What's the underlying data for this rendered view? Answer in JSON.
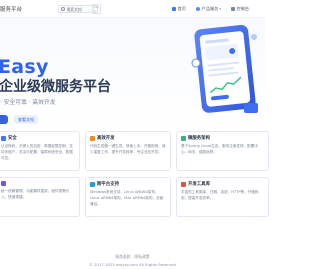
{
  "header": {
    "brand": "服务平台",
    "search_placeholder": "搜索文档",
    "search_shortcut": "Ctrl K",
    "nav": [
      {
        "label": "首页",
        "icon": "home-icon"
      },
      {
        "label": "产品服务",
        "icon": "grid-icon"
      },
      {
        "label": "控制台",
        "icon": "monitor-icon"
      }
    ]
  },
  "hero": {
    "title": "Easy",
    "subtitle": "企业级微服务平台",
    "tagline": "· 安全可靠 · 高效开发",
    "secondary_button": "查看文档",
    "accent_color": "#2f62f0"
  },
  "features": [
    {
      "title": "安全",
      "icon": "shield-icon",
      "icon_color": "#3d7bf5",
      "desc": "认证授权、无侵入的加密、数据权限控制，支持多租户、灵活可配置，保障系统安全、数据可控。"
    },
    {
      "title": "高效开发",
      "icon": "rocket-icon",
      "icon_color": "#f08a24",
      "desc": "代码生成器一键生成，快速上手，开箱即用，减少重复工作，提升开发效率，专注业务开发。"
    },
    {
      "title": "微服务架构",
      "icon": "cluster-icon",
      "icon_color": "#35b37e",
      "desc": "基于Spring Cloud生态，服务注册发现、配置中心、网关、链路追踪。"
    },
    {
      "title": "",
      "icon": "code-icon",
      "icon_color": "#6a5ae0",
      "desc": "统一依赖管理、功能模块插拔、组件按需引入，快速搭建。"
    },
    {
      "title": "跨平台支持",
      "icon": "monitor-icon",
      "icon_color": "#1f9fd9",
      "desc": "Windows系统支持，Linux AMD64架构，Linux ARM64架构，Mac ARM64架构，全面兼容。"
    },
    {
      "title": "开发工具库",
      "icon": "toolbox-icon",
      "icon_color": "#e2513b",
      "desc": "丰富的工具类库，日期、加密、HTTP等，开箱即用，提高开发效率。"
    }
  ],
  "footer": {
    "links": [
      "服务条款",
      "隐私政策"
    ],
    "copyright": "© 2017-2025 easyzy.com All Rights Reserved"
  }
}
